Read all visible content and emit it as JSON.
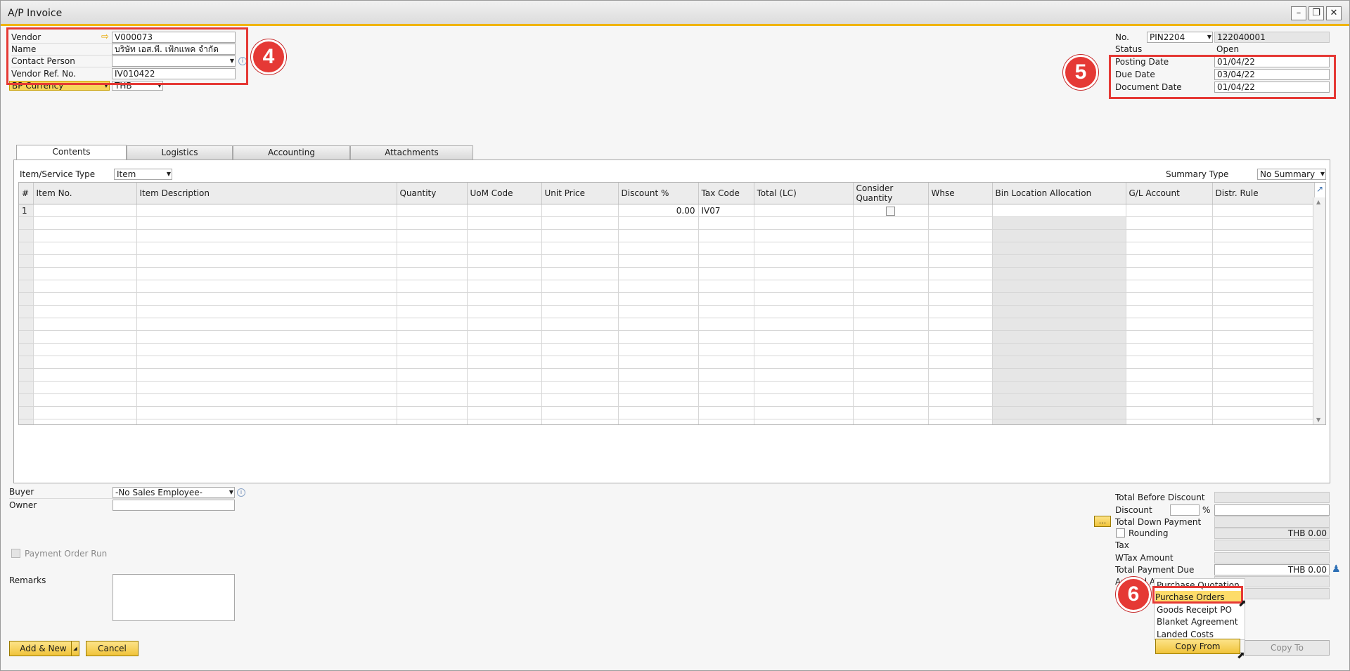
{
  "window": {
    "title": "A/P Invoice"
  },
  "header_left": {
    "vendor_label": "Vendor",
    "vendor_value": "V000073",
    "name_label": "Name",
    "name_value": "บริษัท เอส.พี. เฟ้กแพค จำกัด",
    "contact_label": "Contact Person",
    "contact_value": "",
    "vendor_ref_label": "Vendor Ref. No.",
    "vendor_ref_value": "IV010422",
    "currency_label": "BP Currency",
    "currency_value": "THB"
  },
  "header_right": {
    "no_label": "No.",
    "series_value": "PIN2204",
    "no_value": "122040001",
    "status_label": "Status",
    "status_value": "Open",
    "posting_label": "Posting Date",
    "posting_value": "01/04/22",
    "due_label": "Due Date",
    "due_value": "03/04/22",
    "docdate_label": "Document Date",
    "docdate_value": "01/04/22"
  },
  "tabs": [
    {
      "label": "Contents"
    },
    {
      "label": "Logistics"
    },
    {
      "label": "Accounting"
    },
    {
      "label": "Attachments"
    }
  ],
  "contents": {
    "item_type_label": "Item/Service Type",
    "item_type_value": "Item",
    "summary_label": "Summary Type",
    "summary_value": "No Summary",
    "columns": [
      "#",
      "Item No.",
      "Item Description",
      "Quantity",
      "UoM Code",
      "Unit Price",
      "Discount %",
      "Tax Code",
      "Total (LC)",
      "Consider Quantity",
      "Whse",
      "Bin Location Allocation",
      "G/L Account",
      "Distr. Rule"
    ],
    "row1": {
      "num": "1",
      "discount": "0.00",
      "tax_code": "IV07"
    }
  },
  "footer_left": {
    "buyer_label": "Buyer",
    "buyer_value": "-No Sales Employee-",
    "owner_label": "Owner",
    "owner_value": "",
    "payment_order_label": "Payment Order Run",
    "remarks_label": "Remarks"
  },
  "totals": {
    "before_discount_label": "Total Before Discount",
    "discount_label": "Discount",
    "discount_pct": "%",
    "down_payment_label": "Total Down Payment",
    "ellipsis": "...",
    "rounding_label": "Rounding",
    "rounding_value": "THB 0.00",
    "tax_label": "Tax",
    "wtax_label": "WTax Amount",
    "payment_due_label": "Total Payment Due",
    "payment_due_value": "THB 0.00",
    "applied_label": "Applied Am",
    "balance_label": "B"
  },
  "buttons": {
    "add_new": "Add & New",
    "cancel": "Cancel",
    "copy_from": "Copy From",
    "copy_to": "Copy To"
  },
  "copy_from_menu": [
    "Purchase Quotation",
    "Purchase Orders",
    "Goods Receipt PO",
    "Blanket Agreement",
    "Landed Costs"
  ],
  "annotations": {
    "badge4": "4",
    "badge5": "5",
    "badge6": "6"
  },
  "colors": {
    "accent": "#f0b400",
    "highlight": "#e53935",
    "menu_highlight": "#fddc6a"
  }
}
